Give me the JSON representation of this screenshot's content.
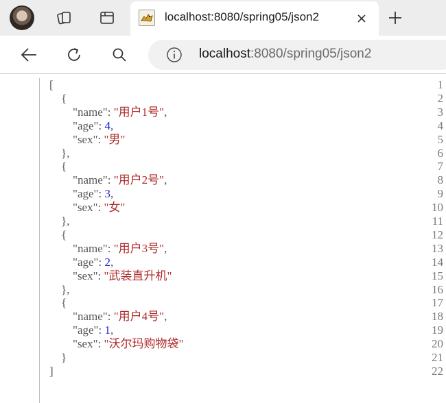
{
  "browser": {
    "tab_title": "localhost:8080/spring05/json2",
    "url_host": "localhost",
    "url_rest": ":8080/spring05/json2",
    "icons": {
      "profile": "avatar",
      "collections": "collections-icon",
      "tab_actions": "tab-actions-icon",
      "close": "close-icon",
      "new_tab": "plus-icon",
      "back": "back-arrow-icon",
      "refresh": "refresh-icon",
      "search": "search-icon",
      "site_info": "info-icon"
    }
  },
  "source": {
    "lines": [
      {
        "n": "1",
        "indent": "",
        "parts": [
          [
            "p",
            "["
          ]
        ]
      },
      {
        "n": "2",
        "indent": "    ",
        "parts": [
          [
            "p",
            "{"
          ]
        ]
      },
      {
        "n": "3",
        "indent": "        ",
        "parts": [
          [
            "k",
            "\"name\""
          ],
          [
            "p",
            ": "
          ],
          [
            "s",
            "\"用户1号\""
          ],
          [
            "p",
            ","
          ]
        ]
      },
      {
        "n": "4",
        "indent": "        ",
        "parts": [
          [
            "k",
            "\"age\""
          ],
          [
            "p",
            ": "
          ],
          [
            "n",
            "4"
          ],
          [
            "p",
            ","
          ]
        ]
      },
      {
        "n": "5",
        "indent": "        ",
        "parts": [
          [
            "k",
            "\"sex\""
          ],
          [
            "p",
            ": "
          ],
          [
            "s",
            "\"男\""
          ]
        ]
      },
      {
        "n": "6",
        "indent": "    ",
        "parts": [
          [
            "p",
            "},"
          ]
        ]
      },
      {
        "n": "7",
        "indent": "    ",
        "parts": [
          [
            "p",
            "{"
          ]
        ]
      },
      {
        "n": "8",
        "indent": "        ",
        "parts": [
          [
            "k",
            "\"name\""
          ],
          [
            "p",
            ": "
          ],
          [
            "s",
            "\"用户2号\""
          ],
          [
            "p",
            ","
          ]
        ]
      },
      {
        "n": "9",
        "indent": "        ",
        "parts": [
          [
            "k",
            "\"age\""
          ],
          [
            "p",
            ": "
          ],
          [
            "n",
            "3"
          ],
          [
            "p",
            ","
          ]
        ]
      },
      {
        "n": "10",
        "indent": "        ",
        "parts": [
          [
            "k",
            "\"sex\""
          ],
          [
            "p",
            ": "
          ],
          [
            "s",
            "\"女\""
          ]
        ]
      },
      {
        "n": "11",
        "indent": "    ",
        "parts": [
          [
            "p",
            "},"
          ]
        ]
      },
      {
        "n": "12",
        "indent": "    ",
        "parts": [
          [
            "p",
            "{"
          ]
        ]
      },
      {
        "n": "13",
        "indent": "        ",
        "parts": [
          [
            "k",
            "\"name\""
          ],
          [
            "p",
            ": "
          ],
          [
            "s",
            "\"用户3号\""
          ],
          [
            "p",
            ","
          ]
        ]
      },
      {
        "n": "14",
        "indent": "        ",
        "parts": [
          [
            "k",
            "\"age\""
          ],
          [
            "p",
            ": "
          ],
          [
            "n",
            "2"
          ],
          [
            "p",
            ","
          ]
        ]
      },
      {
        "n": "15",
        "indent": "        ",
        "parts": [
          [
            "k",
            "\"sex\""
          ],
          [
            "p",
            ": "
          ],
          [
            "s",
            "\"武装直升机\""
          ]
        ]
      },
      {
        "n": "16",
        "indent": "    ",
        "parts": [
          [
            "p",
            "},"
          ]
        ]
      },
      {
        "n": "17",
        "indent": "    ",
        "parts": [
          [
            "p",
            "{"
          ]
        ]
      },
      {
        "n": "18",
        "indent": "        ",
        "parts": [
          [
            "k",
            "\"name\""
          ],
          [
            "p",
            ": "
          ],
          [
            "s",
            "\"用户4号\""
          ],
          [
            "p",
            ","
          ]
        ]
      },
      {
        "n": "19",
        "indent": "        ",
        "parts": [
          [
            "k",
            "\"age\""
          ],
          [
            "p",
            ": "
          ],
          [
            "n",
            "1"
          ],
          [
            "p",
            ","
          ]
        ]
      },
      {
        "n": "20",
        "indent": "        ",
        "parts": [
          [
            "k",
            "\"sex\""
          ],
          [
            "p",
            ": "
          ],
          [
            "s",
            "\"沃尔玛购物袋\""
          ]
        ]
      },
      {
        "n": "21",
        "indent": "    ",
        "parts": [
          [
            "p",
            "}"
          ]
        ]
      },
      {
        "n": "22",
        "indent": "",
        "parts": [
          [
            "p",
            "]"
          ]
        ]
      }
    ]
  },
  "colors": {
    "string": "#b02a2a",
    "number": "#1d1ddb",
    "punctuation": "#555555",
    "line_number": "#7a7a7a"
  }
}
